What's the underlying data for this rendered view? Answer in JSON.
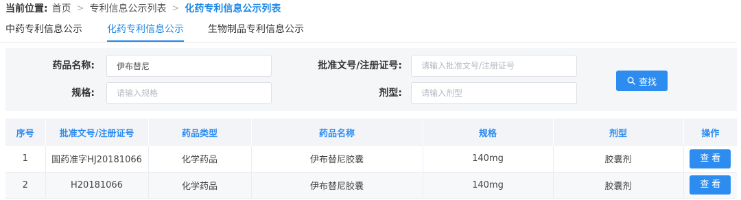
{
  "breadcrumb": {
    "prefix": "当前位置:",
    "items": [
      "首页",
      "专利信息公示列表"
    ],
    "current": "化药专利信息公示列表",
    "separator": ">"
  },
  "tabs": [
    {
      "label": "中药专利信息公示",
      "active": false
    },
    {
      "label": "化药专利信息公示",
      "active": true
    },
    {
      "label": "生物制品专利信息公示",
      "active": false
    }
  ],
  "filter": {
    "drug_name": {
      "label": "药品名称:",
      "value": "伊布替尼",
      "placeholder": ""
    },
    "approval_no": {
      "label": "批准文号/注册证号:",
      "value": "",
      "placeholder": "请输入批准文号/注册证号"
    },
    "spec": {
      "label": "规格:",
      "value": "",
      "placeholder": "请输入规格"
    },
    "dosage_form": {
      "label": "剂型:",
      "value": "",
      "placeholder": "请输入剂型"
    },
    "search_label": "查找",
    "search_icon": "search-icon"
  },
  "table": {
    "columns": [
      "序号",
      "批准文号/注册证号",
      "药品类型",
      "药品名称",
      "规格",
      "剂型",
      "操作"
    ],
    "rows": [
      {
        "no": "1",
        "approval_no": "国药准字HJ20181066",
        "type": "化学药品",
        "name": "伊布替尼胶囊",
        "spec": "140mg",
        "form": "胶囊剂",
        "action": "查看"
      },
      {
        "no": "2",
        "approval_no": "H20181066",
        "type": "化学药品",
        "name": "伊布替尼胶囊",
        "spec": "140mg",
        "form": "胶囊剂",
        "action": "查看"
      }
    ]
  },
  "colors": {
    "accent": "#2d8cf0",
    "header_bg": "#f2f4f7",
    "filter_bg": "#f5f6f8"
  }
}
